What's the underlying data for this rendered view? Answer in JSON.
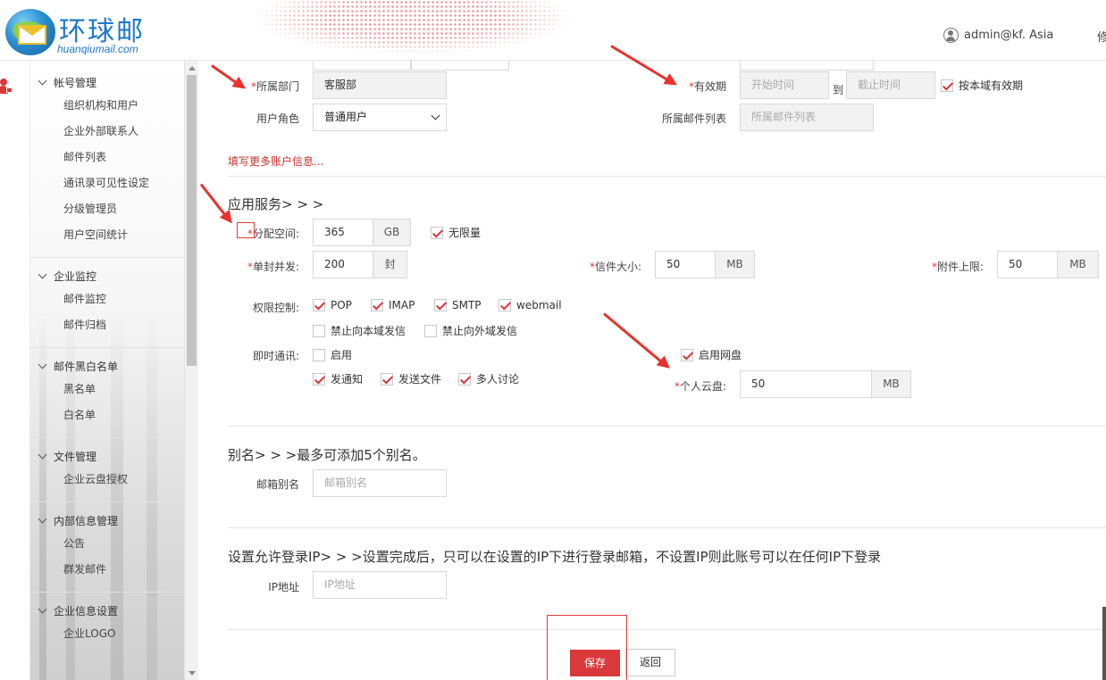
{
  "header": {
    "logo_name": "环球邮",
    "logo_url": "huanqiumail.com",
    "user": "admin@kf.    Asia",
    "edge_text": "修"
  },
  "sidebar": {
    "groups": [
      {
        "title": "帐号管理",
        "items": [
          "组织机构和用户",
          "企业外部联系人",
          "邮件列表",
          "通讯录可见性设定",
          "分级管理员",
          "用户空间统计"
        ]
      },
      {
        "title": "企业监控",
        "items": [
          "邮件监控",
          "邮件归档"
        ]
      },
      {
        "title": "邮件黑白名单",
        "items": [
          "黑名单",
          "白名单"
        ]
      },
      {
        "title": "文件管理",
        "items": [
          "企业云盘授权"
        ]
      },
      {
        "title": "内部信息管理",
        "items": [
          "公告",
          "群发邮件"
        ]
      },
      {
        "title": "企业信息设置",
        "items": [
          "企业LOGO"
        ]
      }
    ]
  },
  "account": {
    "dept_label": "所属部门",
    "dept_value": "客服部",
    "role_label": "用户角色",
    "role_value": "普通用户",
    "validity_label": "有效期",
    "start_placeholder": "开始时间",
    "to_text": "到",
    "end_placeholder": "截止时间",
    "domain_validity_label": "按本域有效期",
    "maillist_label": "所属邮件列表",
    "maillist_placeholder": "所属邮件列表",
    "more_link": "填写更多账户信息..."
  },
  "services": {
    "title": "应用服务> > >",
    "quota_label": "分配空间:",
    "quota_value": "365",
    "quota_unit": "GB",
    "unlimited_label": "无限量",
    "concurrency_label": "单封并发:",
    "concurrency_value": "200",
    "concurrency_unit": "封",
    "mailsize_label": "信件大小:",
    "mailsize_value": "50",
    "mailsize_unit": "MB",
    "attach_label": "附件上限:",
    "attach_value": "50",
    "attach_unit": "MB",
    "perm_label": "权限控制:",
    "perm_pop": "POP",
    "perm_imap": "IMAP",
    "perm_smtp": "SMTP",
    "perm_webmail": "webmail",
    "ban_local": "禁止向本域发信",
    "ban_external": "禁止向外域发信",
    "im_label": "即时通讯:",
    "im_enable": "启用",
    "im_notify": "发通知",
    "im_file": "发送文件",
    "im_discuss": "多人讨论",
    "netdisk_enable": "启用网盘",
    "cloud_label": "个人云盘:",
    "cloud_value": "50",
    "cloud_unit": "MB"
  },
  "alias": {
    "title": "别名> > >最多可添加5个别名。",
    "label": "邮箱别名",
    "placeholder": "邮箱别名"
  },
  "ip": {
    "title": "设置允许登录IP> > >设置完成后，只可以在设置的IP下进行登录邮箱，不设置IP则此账号可以在任何IP下登录",
    "label": "IP地址",
    "placeholder": "IP地址"
  },
  "buttons": {
    "save": "保存",
    "back": "返回"
  },
  "colors": {
    "accent": "#d9393a",
    "brand": "#1f78c8",
    "annotation": "#e8322f"
  }
}
